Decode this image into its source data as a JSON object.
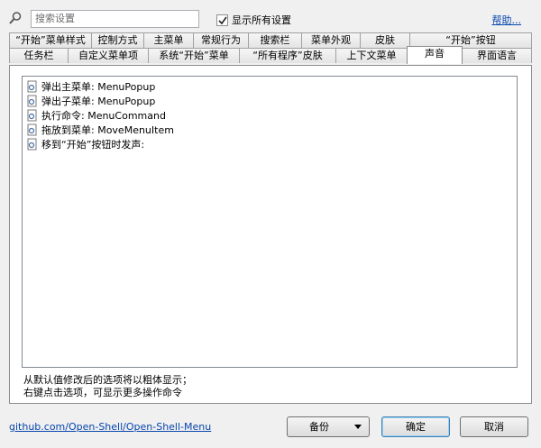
{
  "search": {
    "placeholder": "搜索设置"
  },
  "show_all": {
    "label": "显示所有设置",
    "checked": true
  },
  "help": {
    "label": "帮助..."
  },
  "tabs": {
    "row1": [
      "“开始”菜单样式",
      "控制方式",
      "主菜单",
      "常规行为",
      "搜索栏",
      "菜单外观",
      "皮肤",
      "“开始”按钮"
    ],
    "row2": [
      "任务栏",
      "自定义菜单项",
      "系统“开始”菜单",
      "“所有程序”皮肤",
      "上下文菜单",
      "声音",
      "界面语言"
    ],
    "active": "声音"
  },
  "sound_list": {
    "items": [
      "弹出主菜单: MenuPopup",
      "弹出子菜单: MenuPopup",
      "执行命令: MenuCommand",
      "拖放到菜单: MoveMenuItem",
      "移到“开始”按钮时发声:"
    ]
  },
  "hints": {
    "line1": "从默认值修改后的选项将以粗体显示；",
    "line2": "右键点击选项，可显示更多操作命令"
  },
  "footer": {
    "github_link": "github.com/Open-Shell/Open-Shell-Menu",
    "backup_label": "备份",
    "ok_label": "确定",
    "cancel_label": "取消"
  }
}
